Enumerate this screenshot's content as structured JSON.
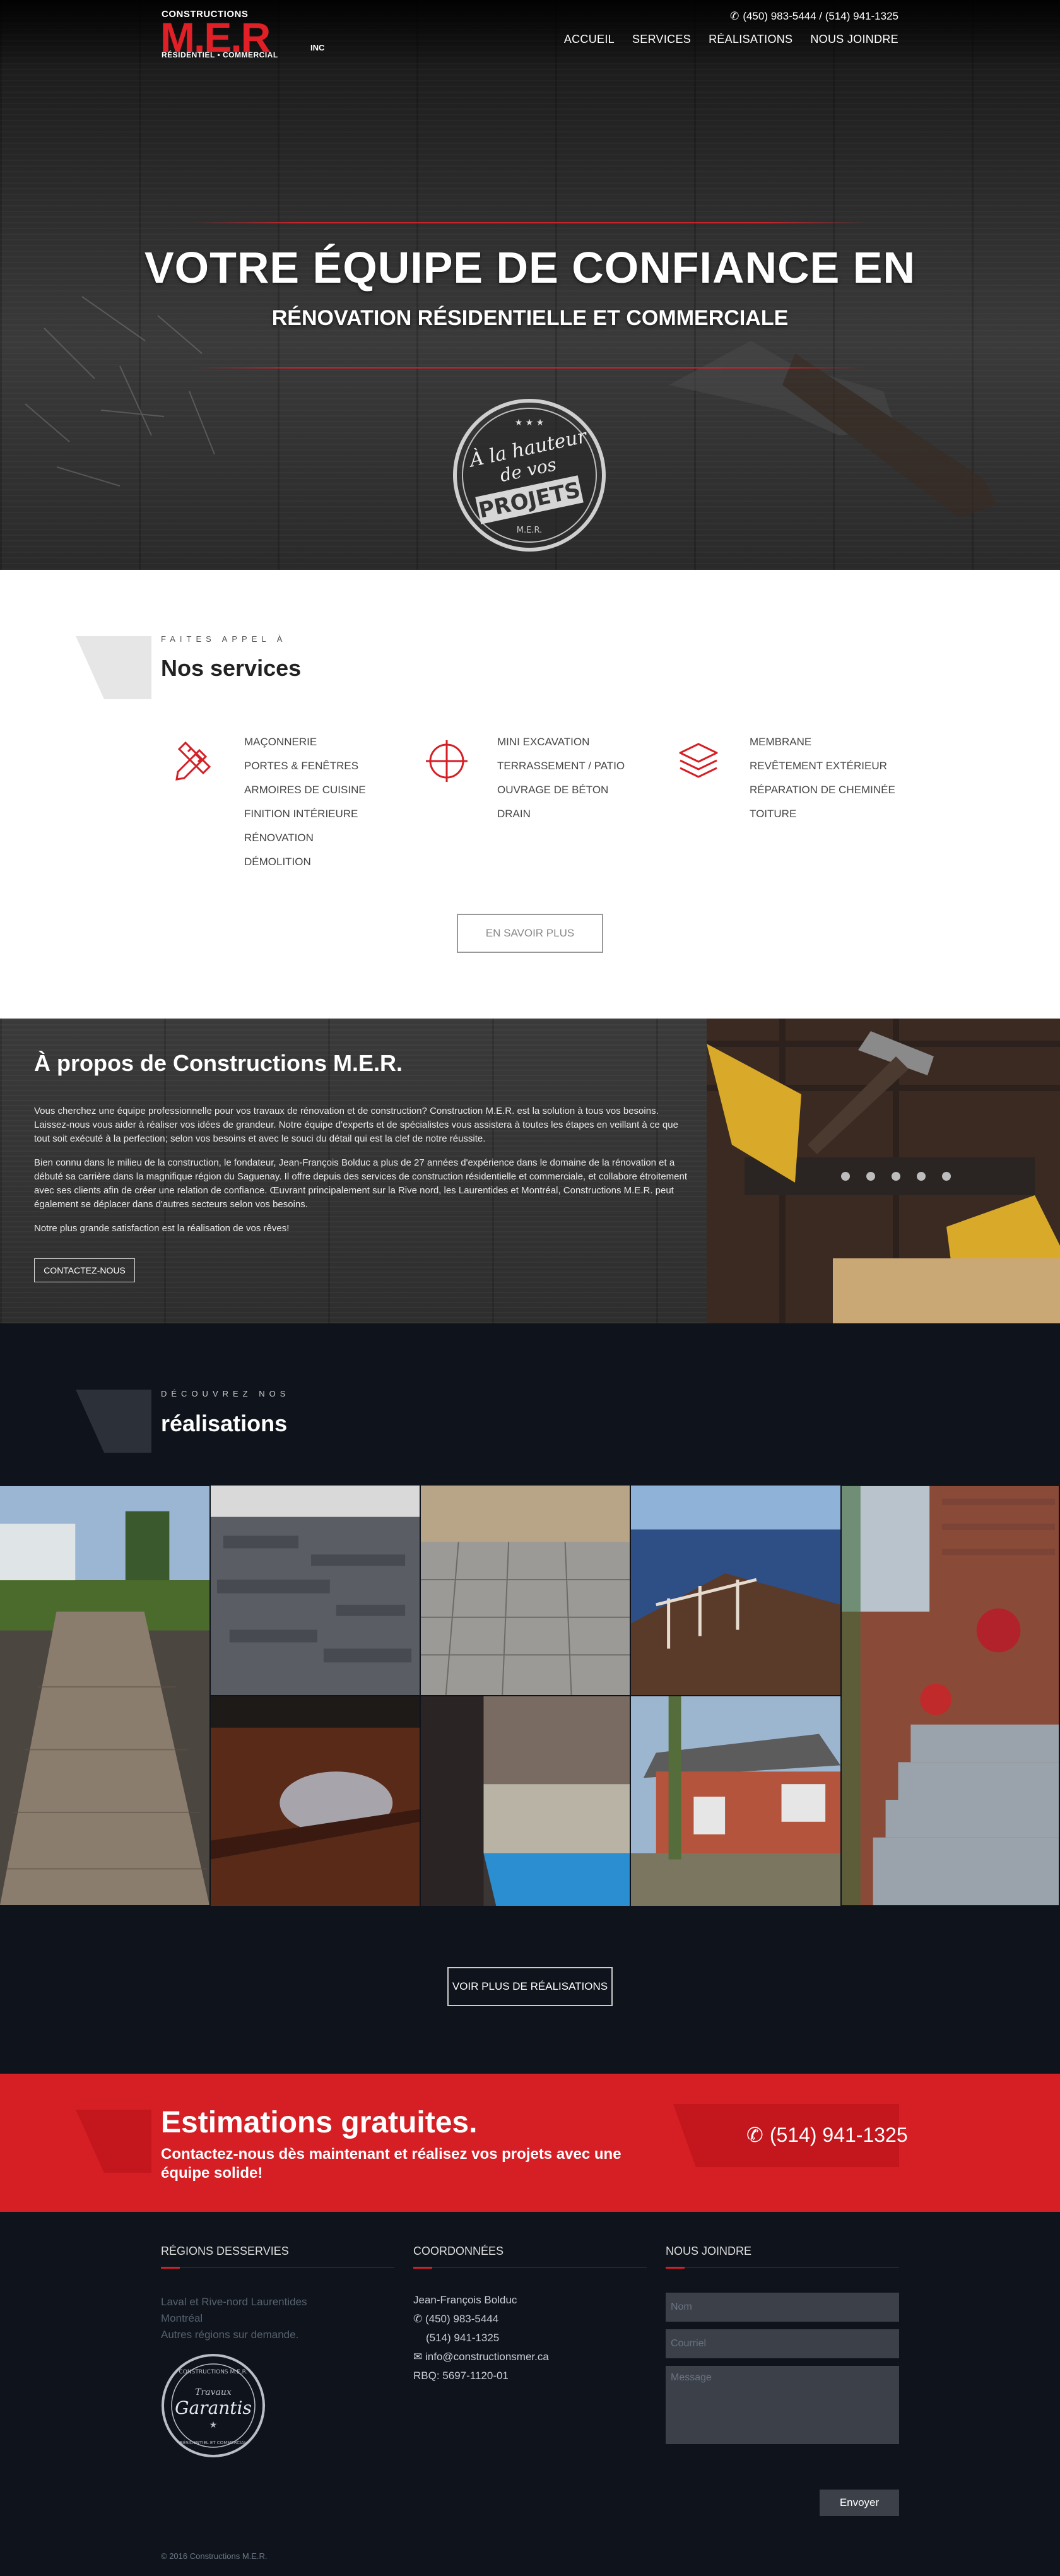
{
  "header": {
    "logo": {
      "line1": "CONSTRUCTIONS",
      "main": "M.E.R",
      "suffix": "INC",
      "tagline": "RÉSIDENTIEL • COMMERCIAL"
    },
    "phones": "(450) 983-5444 / (514) 941-1325",
    "nav": [
      "ACCUEIL",
      "SERVICES",
      "RÉALISATIONS",
      "NOUS JOINDRE"
    ]
  },
  "hero": {
    "title": "VOTRE ÉQUIPE DE CONFIANCE EN",
    "subtitle": "RÉNOVATION RÉSIDENTIELLE ET COMMERCIALE",
    "badge": {
      "line1": "À la hauteur",
      "line2": "de vos",
      "line3": "PROJETS",
      "line4": "M.E.R."
    }
  },
  "services": {
    "eyebrow": "FAITES APPEL À",
    "title": "Nos services",
    "columns": [
      {
        "icon": "pencil-ruler-icon",
        "items": [
          "MAÇONNERIE",
          "PORTES & FENÊTRES",
          "ARMOIRES DE CUISINE",
          "FINITION INTÉRIEURE",
          "RÉNOVATION",
          "DÉMOLITION"
        ]
      },
      {
        "icon": "crosshair-icon",
        "items": [
          "MINI EXCAVATION",
          "TERRASSEMENT / PATIO",
          "OUVRAGE DE BÉTON",
          "DRAIN"
        ]
      },
      {
        "icon": "layers-icon",
        "items": [
          "MEMBRANE",
          "REVÊTEMENT EXTÉRIEUR",
          "RÉPARATION DE CHEMINÉE",
          "TOITURE"
        ]
      }
    ],
    "button": "EN SAVOIR PLUS"
  },
  "about": {
    "title": "À propos de Constructions M.E.R.",
    "p1": "Vous cherchez une équipe professionnelle pour vos travaux de rénovation et de construction? Construction M.E.R. est la solution à tous vos besoins. Laissez-nous vous aider à réaliser vos idées de grandeur. Notre équipe d'experts et de spécialistes vous assistera à toutes les étapes en veillant à ce que tout soit exécuté à la perfection; selon vos besoins et avec le souci du détail qui est la clef de notre réussite.",
    "p2": "Bien connu dans le milieu de la construction, le fondateur, Jean-François Bolduc a plus de 27 années d'expérience dans le domaine de la rénovation et a débuté sa carrière dans la magnifique région du Saguenay. Il offre depuis des services de construction résidentielle et commerciale, et collabore étroitement avec ses clients afin de créer une relation de confiance. Œuvrant principalement sur la Rive nord, les Laurentides et Montréal, Constructions M.E.R. peut également se déplacer dans d'autres secteurs selon vos besoins.",
    "p3": "Notre plus grande satisfaction est la réalisation de vos rêves!",
    "button": "CONTACTEZ-NOUS"
  },
  "realisations": {
    "eyebrow": "DÉCOUVREZ NOS",
    "title": "réalisations",
    "button": "VOIR PLUS DE RÉALISATIONS"
  },
  "cta": {
    "title": "Estimations gratuites.",
    "subtitle": "Contactez-nous dès maintenant et réalisez vos projets avec une équipe solide!",
    "phone": "(514) 941-1325"
  },
  "footer": {
    "regions": {
      "title": "RÉGIONS DESSERVIES",
      "lines": [
        "Laval et Rive-nord Laurentides",
        "Montréal",
        "Autres régions sur demande."
      ]
    },
    "seal": {
      "top": "CONSTRUCTIONS M.E.R.",
      "script": "Garantis",
      "pre": "Travaux",
      "bottom": "RÉSIDENTIEL ET COMMERCIAL"
    },
    "contact": {
      "title": "COORDONNÉES",
      "name": "Jean-François Bolduc",
      "phone1": "(450) 983-5444",
      "phone2": "(514) 941-1325",
      "email": "info@constructionsmer.ca",
      "rbq": "RBQ: 5697-1120-01"
    },
    "form": {
      "title": "NOUS JOINDRE",
      "name_placeholder": "Nom",
      "email_placeholder": "Courriel",
      "message_placeholder": "Message",
      "send": "Envoyer"
    },
    "copyright": "© 2016 Constructions M.E.R."
  }
}
